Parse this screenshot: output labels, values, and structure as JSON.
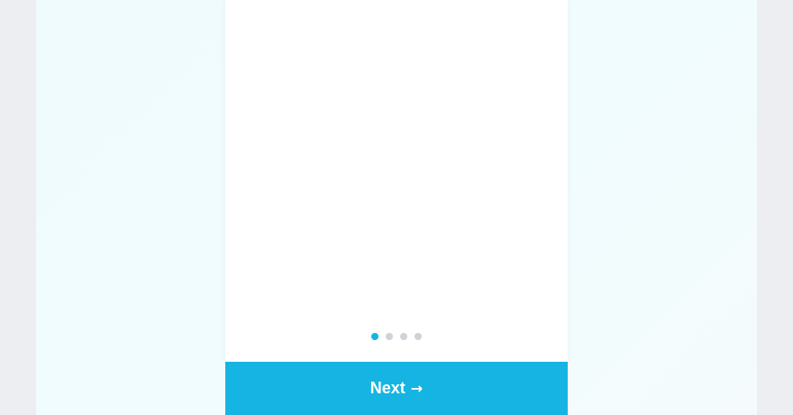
{
  "onboarding": {
    "pager": {
      "total": 4,
      "active_index": 0
    },
    "next_button": {
      "label": "Next",
      "icon": "arrow-right-icon",
      "icon_glyph": "→"
    }
  },
  "colors": {
    "accent": "#16b4e2",
    "dot_inactive": "#cdd3d9",
    "page_background": "#eceef1",
    "stage_background": "#effbfd",
    "card_background": "#ffffff"
  }
}
